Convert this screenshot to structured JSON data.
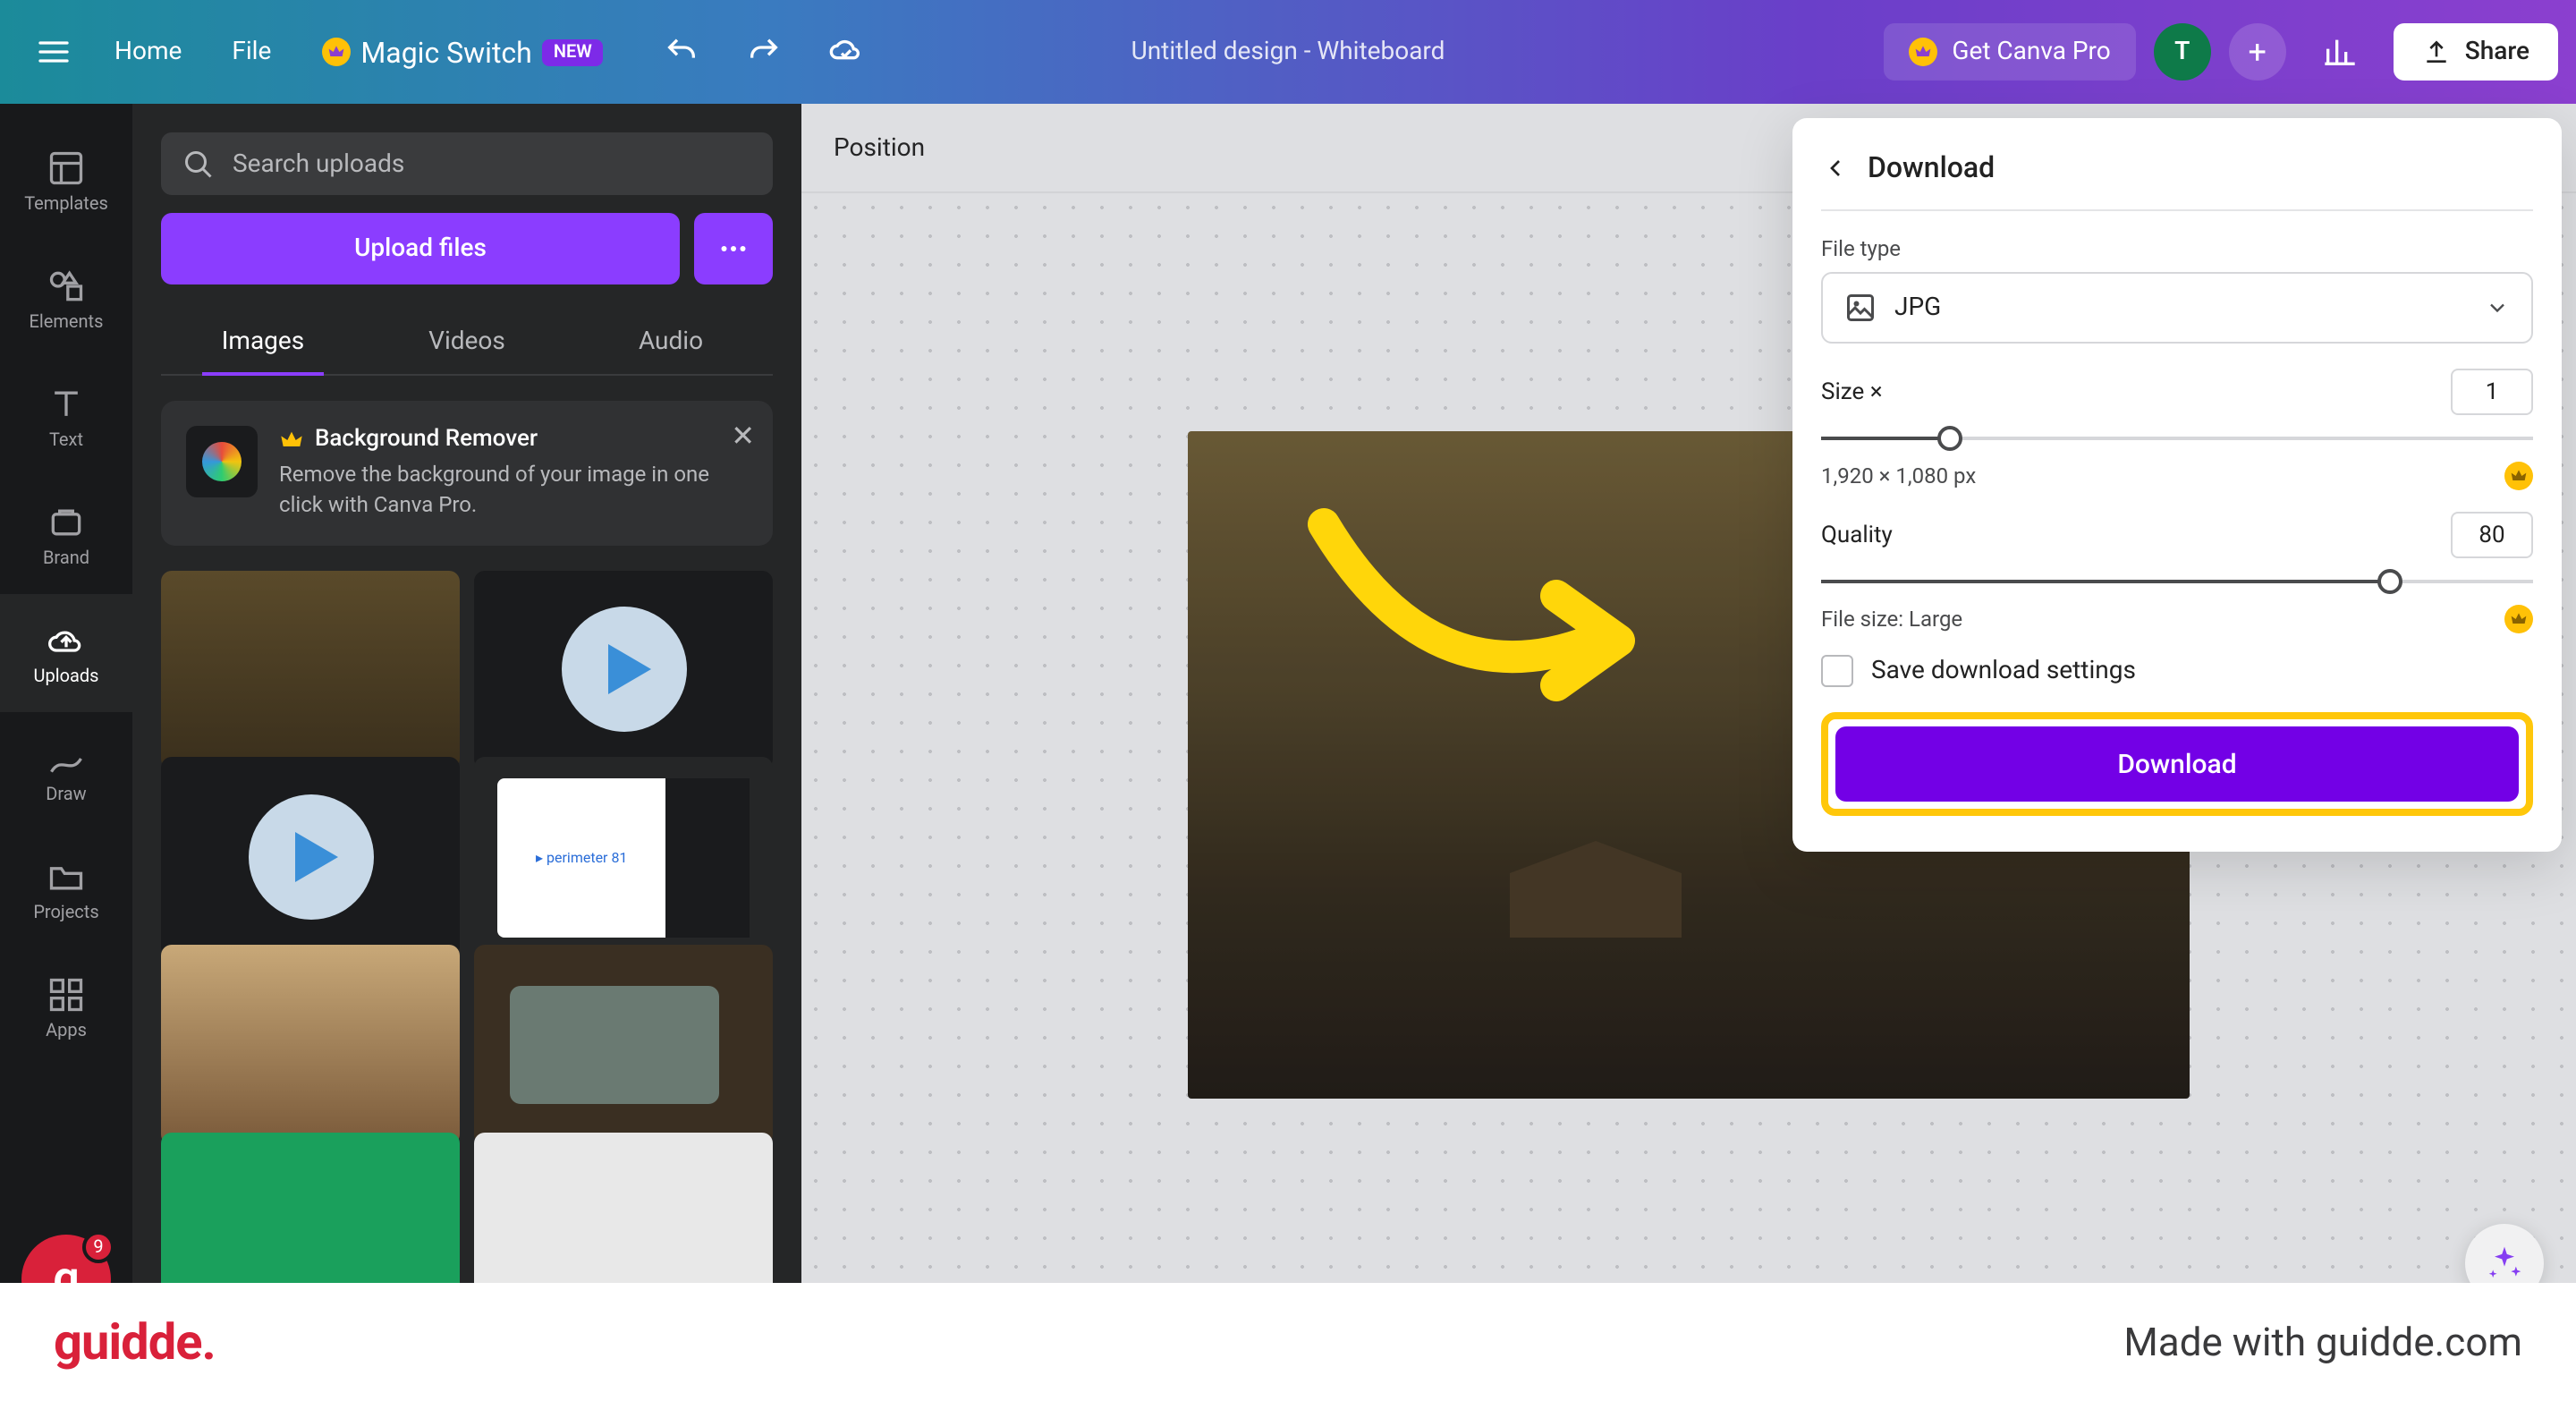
{
  "topbar": {
    "home": "Home",
    "file": "File",
    "magic_switch": "Magic Switch",
    "new_badge": "NEW",
    "doc_title": "Untitled design - Whiteboard",
    "get_pro": "Get Canva Pro",
    "avatar_initial": "T",
    "share": "Share"
  },
  "rail": [
    {
      "id": "templates",
      "label": "Templates"
    },
    {
      "id": "elements",
      "label": "Elements"
    },
    {
      "id": "text",
      "label": "Text"
    },
    {
      "id": "brand",
      "label": "Brand"
    },
    {
      "id": "uploads",
      "label": "Uploads"
    },
    {
      "id": "draw",
      "label": "Draw"
    },
    {
      "id": "projects",
      "label": "Projects"
    },
    {
      "id": "apps",
      "label": "Apps"
    }
  ],
  "rail_badge_count": "9",
  "side": {
    "search_placeholder": "Search uploads",
    "upload_btn": "Upload files",
    "tabs": [
      "Images",
      "Videos",
      "Audio"
    ],
    "active_tab": 0,
    "bg_remover_title": "Background Remover",
    "bg_remover_desc": "Remove the background of your image in one click with Canva Pro."
  },
  "canvas": {
    "position_label": "Position"
  },
  "download": {
    "title": "Download",
    "file_type_label": "File type",
    "file_type_value": "JPG",
    "size_label": "Size ×",
    "size_value": "1",
    "dimensions": "1,920 × 1,080 px",
    "quality_label": "Quality",
    "quality_value": "80",
    "file_size": "File size: Large",
    "save_settings": "Save download settings",
    "download_btn": "Download",
    "size_slider_pct": 18,
    "quality_slider_pct": 80
  },
  "footer": {
    "logo": "guidde.",
    "made": "Made with guidde.com"
  }
}
